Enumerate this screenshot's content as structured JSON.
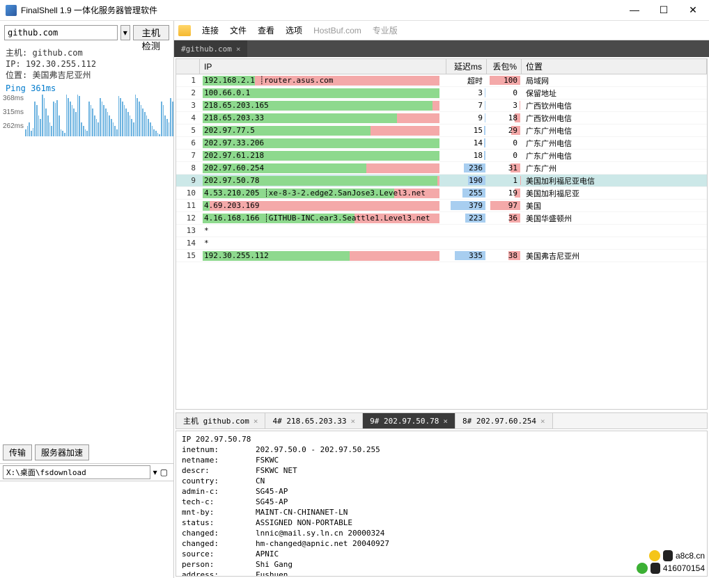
{
  "window": {
    "title": "FinalShell 1.9 一体化服务器管理软件",
    "minimize": "—",
    "maximize": "☐",
    "close": "✕"
  },
  "left": {
    "host_value": "github.com",
    "check_label": "主机检测",
    "info_host_label": "主机:",
    "info_host": "github.com",
    "info_ip_label": "IP:",
    "info_ip": "192.30.255.112",
    "info_loc_label": "位置:",
    "info_loc": "美国弗吉尼亚州",
    "ping_line": "Ping 361ms",
    "ping_y": [
      "368ms",
      "315ms",
      "262ms"
    ],
    "tab_transfer": "传输",
    "tab_accel": "服务器加速",
    "path_value": "X:\\桌面\\fsdownload"
  },
  "toolbar": {
    "connect": "连接",
    "file": "文件",
    "view": "查看",
    "options": "选项",
    "hostbuf": "HostBuf.com",
    "pro": "专业版"
  },
  "tab": {
    "label": "#github.com"
  },
  "table": {
    "col_ip": "IP",
    "col_delay": "延迟ms",
    "col_loss": "丢包%",
    "col_loc": "位置",
    "timeout": "超时",
    "rows": [
      {
        "n": 1,
        "ip": "192.168.2.1",
        "host": "router.asus.com",
        "delay": "超时",
        "loss": 100,
        "loc": "局域网",
        "bar_green": 22,
        "bar_red": 78,
        "d_bar": 0,
        "l_bar": 100
      },
      {
        "n": 2,
        "ip": "100.66.0.1",
        "host": "",
        "delay": 3,
        "loss": 0,
        "loc": "保留地址",
        "bar_green": 100,
        "bar_red": 0,
        "d_bar": 2,
        "l_bar": 0
      },
      {
        "n": 3,
        "ip": "218.65.203.165",
        "host": "",
        "delay": 7,
        "loss": 3,
        "loc": "广西钦州电信",
        "bar_green": 97,
        "bar_red": 3,
        "d_bar": 3,
        "l_bar": 3
      },
      {
        "n": 4,
        "ip": "218.65.203.33",
        "host": "",
        "delay": 9,
        "loss": 18,
        "loc": "广西钦州电信",
        "bar_green": 82,
        "bar_red": 18,
        "d_bar": 3,
        "l_bar": 18
      },
      {
        "n": 5,
        "ip": "202.97.77.5",
        "host": "",
        "delay": 15,
        "loss": 29,
        "loc": "广东广州电信",
        "bar_green": 71,
        "bar_red": 29,
        "d_bar": 5,
        "l_bar": 29
      },
      {
        "n": 6,
        "ip": "202.97.33.206",
        "host": "",
        "delay": 14,
        "loss": 0,
        "loc": "广东广州电信",
        "bar_green": 100,
        "bar_red": 0,
        "d_bar": 5,
        "l_bar": 0
      },
      {
        "n": 7,
        "ip": "202.97.61.218",
        "host": "",
        "delay": 18,
        "loss": 0,
        "loc": "广东广州电信",
        "bar_green": 100,
        "bar_red": 0,
        "d_bar": 5,
        "l_bar": 0
      },
      {
        "n": 8,
        "ip": "202.97.60.254",
        "host": "",
        "delay": 236,
        "loss": 31,
        "loc": "广东广州",
        "bar_green": 69,
        "bar_red": 31,
        "d_bar": 62,
        "l_bar": 31
      },
      {
        "n": 9,
        "ip": "202.97.50.78",
        "host": "",
        "delay": 190,
        "loss": 1,
        "loc": "美国加利福尼亚电信",
        "bar_green": 99,
        "bar_red": 1,
        "d_bar": 50,
        "l_bar": 1,
        "selected": true
      },
      {
        "n": 10,
        "ip": "4.53.210.205",
        "host": "xe-8-3-2.edge2.SanJose3.Level3.net",
        "delay": 255,
        "loss": 19,
        "loc": "美国加利福尼亚",
        "bar_green": 81,
        "bar_red": 19,
        "d_bar": 67,
        "l_bar": 19
      },
      {
        "n": 11,
        "ip": "4.69.203.169",
        "host": "",
        "delay": 379,
        "loss": 97,
        "loc": "美国",
        "bar_green": 3,
        "bar_red": 97,
        "d_bar": 100,
        "l_bar": 97
      },
      {
        "n": 12,
        "ip": "4.16.168.166",
        "host": "GITHUB-INC.ear3.Seattle1.Level3.net",
        "delay": 223,
        "loss": 36,
        "loc": "美国华盛顿州",
        "bar_green": 64,
        "bar_red": 36,
        "d_bar": 59,
        "l_bar": 36
      },
      {
        "n": 13,
        "ip": "*",
        "host": "",
        "delay": "",
        "loss": "",
        "loc": "",
        "bar_green": 0,
        "bar_red": 0,
        "d_bar": 0,
        "l_bar": 0
      },
      {
        "n": 14,
        "ip": "*",
        "host": "",
        "delay": "",
        "loss": "",
        "loc": "",
        "bar_green": 0,
        "bar_red": 0,
        "d_bar": 0,
        "l_bar": 0
      },
      {
        "n": 15,
        "ip": "192.30.255.112",
        "host": "",
        "delay": 335,
        "loss": 38,
        "loc": "美国弗吉尼亚州",
        "bar_green": 62,
        "bar_red": 38,
        "d_bar": 88,
        "l_bar": 38
      }
    ]
  },
  "bottom_tabs": [
    {
      "label": "主机 github.com",
      "active": false
    },
    {
      "label": "4# 218.65.203.33",
      "active": false
    },
    {
      "label": "9# 202.97.50.78",
      "active": true
    },
    {
      "label": "8# 202.97.60.254",
      "active": false
    }
  ],
  "whois": {
    "lines": [
      "IP 202.97.50.78",
      "inetnum:        202.97.50.0 - 202.97.50.255",
      "netname:        FSKWC",
      "descr:          FSKWC NET",
      "country:        CN",
      "admin-c:        SG45-AP",
      "tech-c:         SG45-AP",
      "mnt-by:         MAINT-CN-CHINANET-LN",
      "status:         ASSIGNED NON-PORTABLE",
      "changed:        lnnic@mail.sy.ln.cn 20000324",
      "changed:        hm-changed@apnic.net 20040927",
      "source:         APNIC",
      "person:         Shi Gang",
      "address:        Fushuen"
    ]
  },
  "watermark": {
    "url": "a8c8.cn",
    "qq": "416070154"
  }
}
